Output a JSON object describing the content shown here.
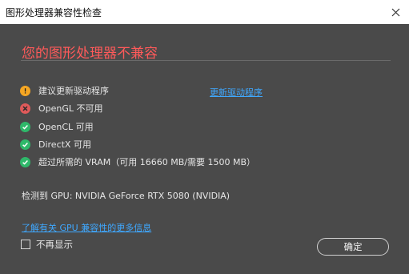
{
  "window": {
    "title": "图形处理器兼容性检查"
  },
  "dialog": {
    "heading": "您的图形处理器不兼容",
    "checks": [
      {
        "icon": "warning-icon",
        "status": "warning",
        "label": "建议更新驱动程序"
      },
      {
        "icon": "error-icon",
        "status": "error",
        "label": "OpenGL 不可用"
      },
      {
        "icon": "check-icon",
        "status": "ok",
        "label": "OpenCL 可用"
      },
      {
        "icon": "check-icon",
        "status": "ok",
        "label": "DirectX 可用"
      },
      {
        "icon": "check-icon",
        "status": "ok",
        "label": "超过所需的 VRAM（可用 16660 MB/需要 1500 MB）"
      }
    ],
    "update_link": "更新驱动程序",
    "gpu_detected": "检测到 GPU: NVIDIA GeForce RTX 5080 (NVIDIA)",
    "learn_more_link": "了解有关 GPU 兼容性的更多信息",
    "dont_show_label": "不再显示",
    "dont_show_checked": false,
    "ok_label": "确定"
  },
  "colors": {
    "background": "#4a4a4a",
    "heading": "#ff5a5a",
    "link": "#3fa8ff",
    "warning": "#f5a623",
    "error": "#e05a5a",
    "ok": "#2fb86a"
  }
}
